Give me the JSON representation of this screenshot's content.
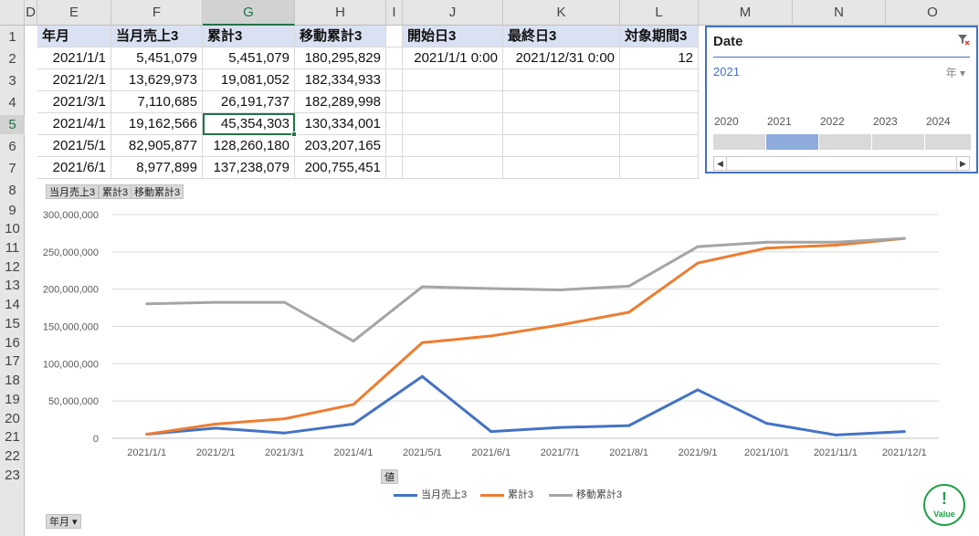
{
  "columns": [
    "D",
    "E",
    "F",
    "G",
    "H",
    "I",
    "J",
    "K",
    "L",
    "M",
    "N",
    "O"
  ],
  "rows": [
    "1",
    "2",
    "3",
    "4",
    "5",
    "6",
    "7",
    "8",
    "9",
    "10",
    "11",
    "12",
    "13",
    "14",
    "15",
    "16",
    "17",
    "18",
    "19",
    "20",
    "21",
    "22",
    "23"
  ],
  "table": {
    "headers": [
      "年月",
      "当月売上3",
      "累計3",
      "移動累計3"
    ],
    "rows": [
      [
        "2021/1/1",
        "5,451,079",
        "5,451,079",
        "180,295,829"
      ],
      [
        "2021/2/1",
        "13,629,973",
        "19,081,052",
        "182,334,933"
      ],
      [
        "2021/3/1",
        "7,110,685",
        "26,191,737",
        "182,289,998"
      ],
      [
        "2021/4/1",
        "19,162,566",
        "45,354,303",
        "130,334,001"
      ],
      [
        "2021/5/1",
        "82,905,877",
        "128,260,180",
        "203,207,165"
      ],
      [
        "2021/6/1",
        "8,977,899",
        "137,238,079",
        "200,755,451"
      ]
    ]
  },
  "period": {
    "headers": [
      "開始日3",
      "最終日3",
      "対象期間3"
    ],
    "values": [
      "2021/1/1 0:00",
      "2021/12/31 0:00",
      "12"
    ]
  },
  "slicer": {
    "title": "Date",
    "selection": "2021",
    "level": "年",
    "years": [
      "2020",
      "2021",
      "2022",
      "2023",
      "2024"
    ],
    "selected_year": "2021",
    "accent": "#4472c4"
  },
  "pivot_buttons": {
    "values": [
      "当月売上3",
      "累計3",
      "移動累計3"
    ],
    "axis_value": "値",
    "row_field": "年月"
  },
  "badge": {
    "symbol": "!",
    "text": "Value",
    "color": "#1e9e48"
  },
  "chart_data": {
    "type": "line",
    "categories": [
      "2021/1/1",
      "2021/2/1",
      "2021/3/1",
      "2021/4/1",
      "2021/5/1",
      "2021/6/1",
      "2021/7/1",
      "2021/8/1",
      "2021/9/1",
      "2021/10/1",
      "2021/11/1",
      "2021/12/1"
    ],
    "ylim": [
      0,
      300000000
    ],
    "yticks": [
      "0",
      "50,000,000",
      "100,000,000",
      "150,000,000",
      "200,000,000",
      "250,000,000",
      "300,000,000"
    ],
    "grid": true,
    "legend": "bottom",
    "series": [
      {
        "name": "当月売上3",
        "color": "#4472c4",
        "values": [
          5451079,
          13629973,
          7110685,
          19162566,
          82905877,
          8977899,
          14500000,
          17000000,
          65000000,
          20000000,
          4500000,
          9000000
        ]
      },
      {
        "name": "累計3",
        "color": "#ed7d31",
        "values": [
          5451079,
          19081052,
          26191737,
          45354303,
          128260180,
          137238079,
          152000000,
          169000000,
          235000000,
          255000000,
          259000000,
          268000000
        ]
      },
      {
        "name": "移動累計3",
        "color": "#a5a5a5",
        "values": [
          180295829,
          182334933,
          182289998,
          130334001,
          203207165,
          200755451,
          199000000,
          204000000,
          257000000,
          263000000,
          263000000,
          268000000
        ]
      }
    ]
  }
}
